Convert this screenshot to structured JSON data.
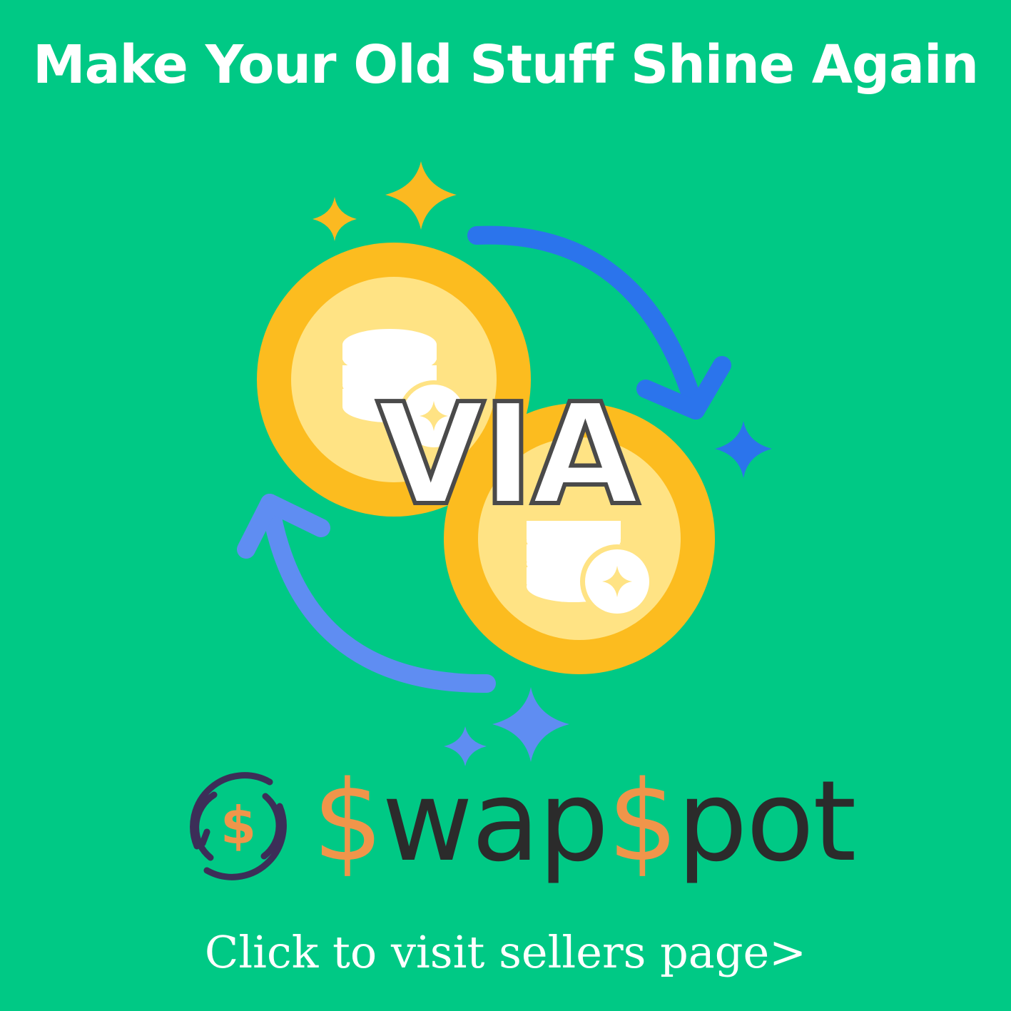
{
  "headline": "Make Your Old Stuff Shine Again",
  "center_word": "VIA",
  "brand": {
    "dollar_1": "$",
    "word_1": "wap",
    "dollar_2": "$",
    "word_2": "pot",
    "emblem_symbol": "$"
  },
  "cta": "Click to visit sellers page>",
  "icons": [
    "sparkle-icon",
    "coin-stack-icon",
    "exchange-arrow-icon",
    "swapspot-logo-icon"
  ],
  "colors": {
    "background": "#00c985",
    "coin_outer": "#fcbc1f",
    "coin_inner": "#ffe384",
    "arrow_blue": "#2b74ec",
    "arrow_light_blue": "#5f8df2",
    "sparkle_gold": "#fbb921",
    "sparkle_blue": "#2b74ec",
    "brand_orange": "#f0954a",
    "brand_dark": "#2b2b2b",
    "logo_purple": "#3c2e58"
  }
}
